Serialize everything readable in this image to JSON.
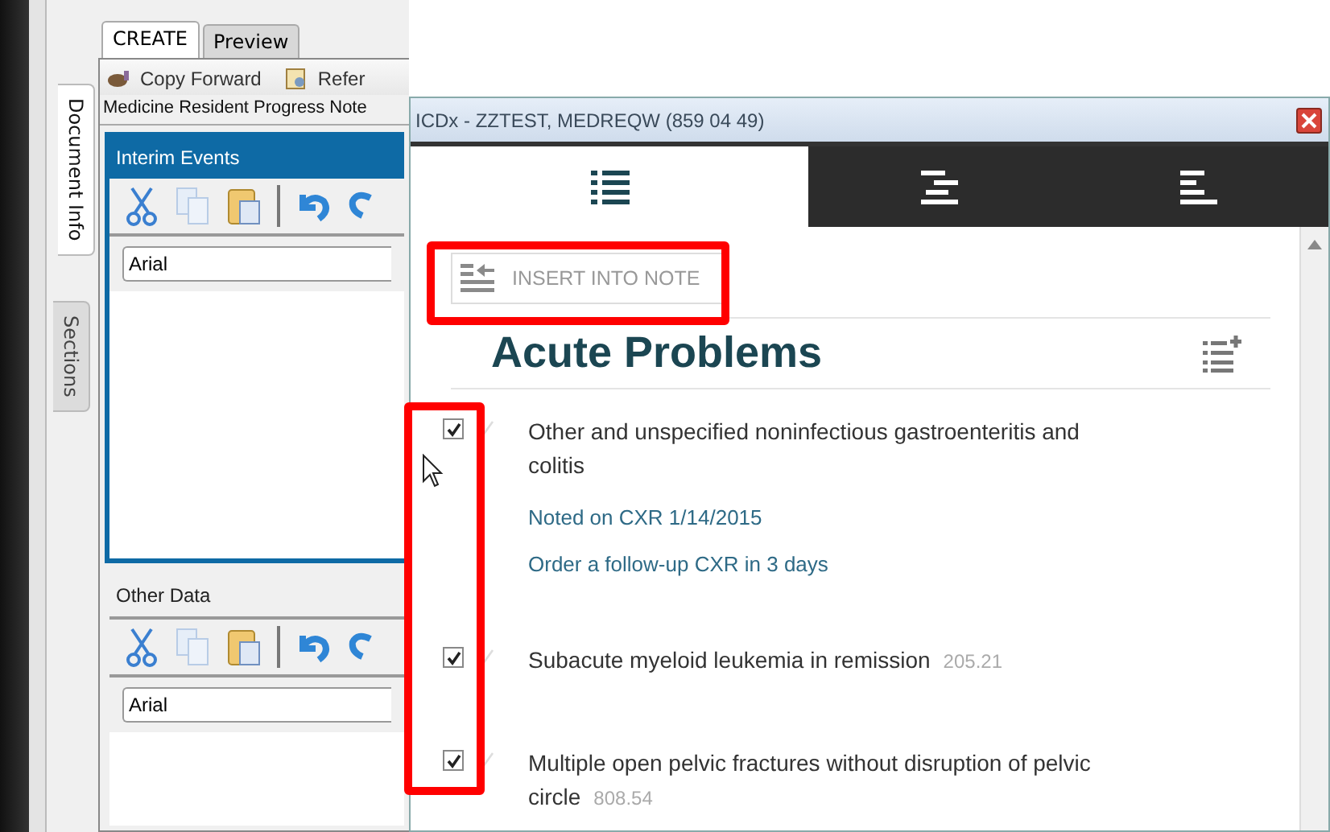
{
  "app": {
    "tabs": [
      {
        "label": "CREATE",
        "selected": true
      },
      {
        "label": "Preview",
        "selected": false
      }
    ],
    "side_tabs": [
      {
        "label": "Document Info",
        "selected": true
      },
      {
        "label": "Sections",
        "selected": false
      }
    ],
    "toolbar": [
      {
        "kind": "copy-forward",
        "label": "Copy Forward"
      },
      {
        "kind": "refer",
        "label": "Refer"
      }
    ],
    "note_title": "Medicine Resident Progress Note",
    "sections": [
      {
        "title": "Interim Events",
        "active": true,
        "font": "Arial"
      },
      {
        "title": "Other Data",
        "active": false,
        "font": "Arial"
      }
    ]
  },
  "dialog": {
    "title": "ICDx - ZZTEST, MEDREQW (859 04 49)",
    "tabs": [
      {
        "kind": "list",
        "selected": true
      },
      {
        "kind": "center",
        "selected": false
      },
      {
        "kind": "left",
        "selected": false
      }
    ],
    "insert_button": "INSERT INTO NOTE",
    "heading": "Acute Problems",
    "problems": [
      {
        "text": "Other and unspecified noninfectious gastroenteritis and colitis",
        "checked": true,
        "notes": [
          "Noted on CXR 1/14/2015",
          "Order a follow-up CXR in 3 days"
        ]
      },
      {
        "text": "Subacute myeloid leukemia in remission",
        "code": "205.21",
        "checked": true
      },
      {
        "text": "Multiple open pelvic fractures without disruption of pelvic circle",
        "code": "808.54",
        "checked": true
      }
    ]
  }
}
